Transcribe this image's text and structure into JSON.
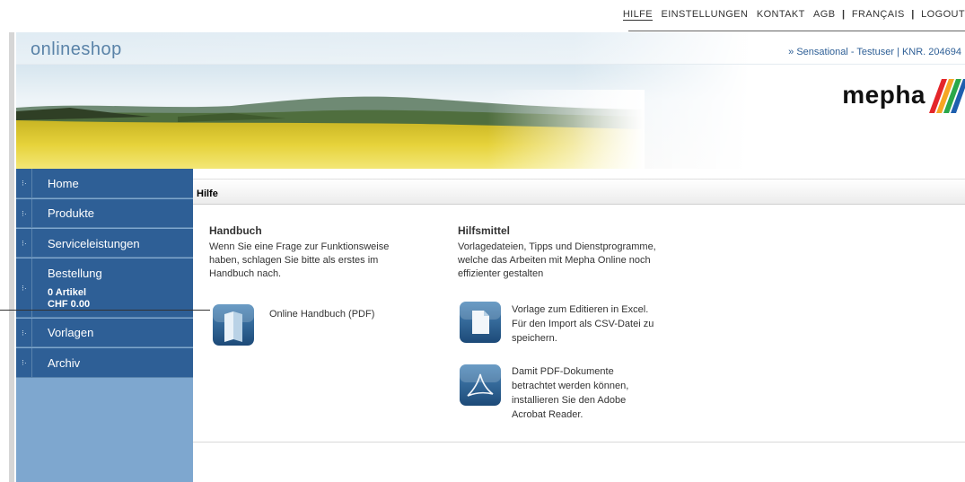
{
  "topnav": {
    "links": [
      "HILFE",
      "EINSTELLUNGEN",
      "KONTAKT",
      "AGB",
      "FRANÇAIS",
      "LOGOUT"
    ]
  },
  "header": {
    "brand": "onlineshop",
    "user_info": "» Sensational - Testuser | KNR. 204694",
    "logo_text": "mepha"
  },
  "sidebar": {
    "items": [
      {
        "label": "Home"
      },
      {
        "label": "Produkte"
      },
      {
        "label": "Serviceleistungen"
      },
      {
        "label": "Bestellung",
        "sub1": "0 Artikel",
        "sub2": "CHF 0.00"
      },
      {
        "label": "Vorlagen"
      },
      {
        "label": "Archiv"
      }
    ]
  },
  "breadcrumb": "Hilfe",
  "handbuch": {
    "title": "Handbuch",
    "text": [
      "Wenn Sie eine Frage zur Funktionsweise",
      "haben, schlagen Sie bitte als erstes im",
      "Handbuch nach."
    ],
    "link": "Online Handbuch (PDF)"
  },
  "hilfsmittel": {
    "title": "Hilfsmittel",
    "text": [
      "Vorlagedateien, Tipps und Dienstprogramme,",
      "welche das Arbeiten mit Mepha Online noch",
      "effizienter gestalten"
    ],
    "excel_text": [
      "Vorlage zum Editieren in Excel.",
      "Für den Import als CSV-Datei zu",
      "speichern."
    ],
    "acrobat_text": [
      "Damit PDF-Dokumente",
      "betrachtet werden können,",
      "installieren Sie den Adobe",
      "Acrobat Reader."
    ]
  },
  "colors": {
    "nav_blue": "#2e5f96",
    "sidebar_bg": "#7ea7cf",
    "brand_blue": "#5a83a8"
  }
}
